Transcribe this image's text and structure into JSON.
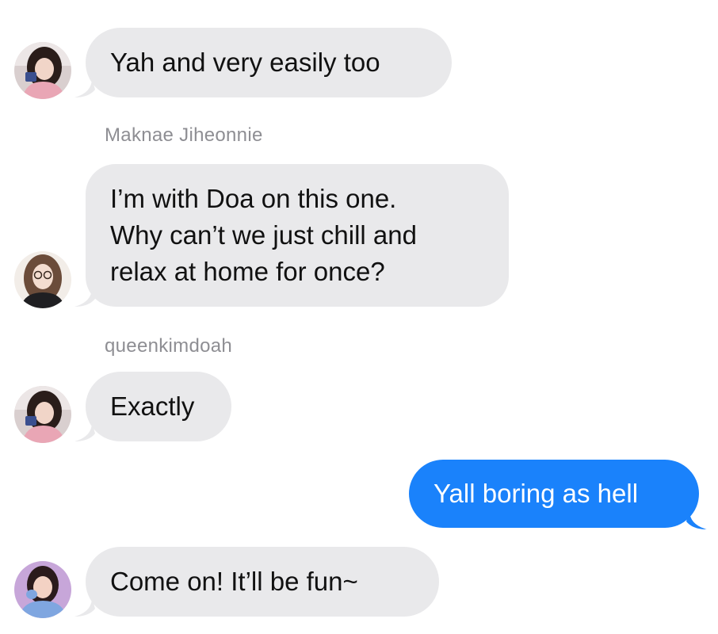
{
  "messages": [
    {
      "type": "incoming",
      "avatar": "avatar-girl-pink-sweater",
      "text": "Yah and very easily too"
    },
    {
      "type": "sender",
      "text": "Maknae Jiheonnie"
    },
    {
      "type": "incoming",
      "avatar": "avatar-girl-glasses",
      "lines": [
        "I’m with Doa on this one.",
        "Why can’t we just chill and",
        "relax at home for once?"
      ]
    },
    {
      "type": "sender",
      "text": "queenkimdoah"
    },
    {
      "type": "incoming",
      "avatar": "avatar-girl-pink-sweater",
      "text": "Exactly"
    },
    {
      "type": "outgoing",
      "text": "Yall boring as hell"
    },
    {
      "type": "incoming",
      "avatar": "avatar-girl-blue-sweater",
      "text": "Come on! It’ll be fun~"
    }
  ],
  "colors": {
    "incoming_bubble": "#e9e9eb",
    "outgoing_bubble": "#1a82fb",
    "sender_label": "#8e8e93"
  }
}
